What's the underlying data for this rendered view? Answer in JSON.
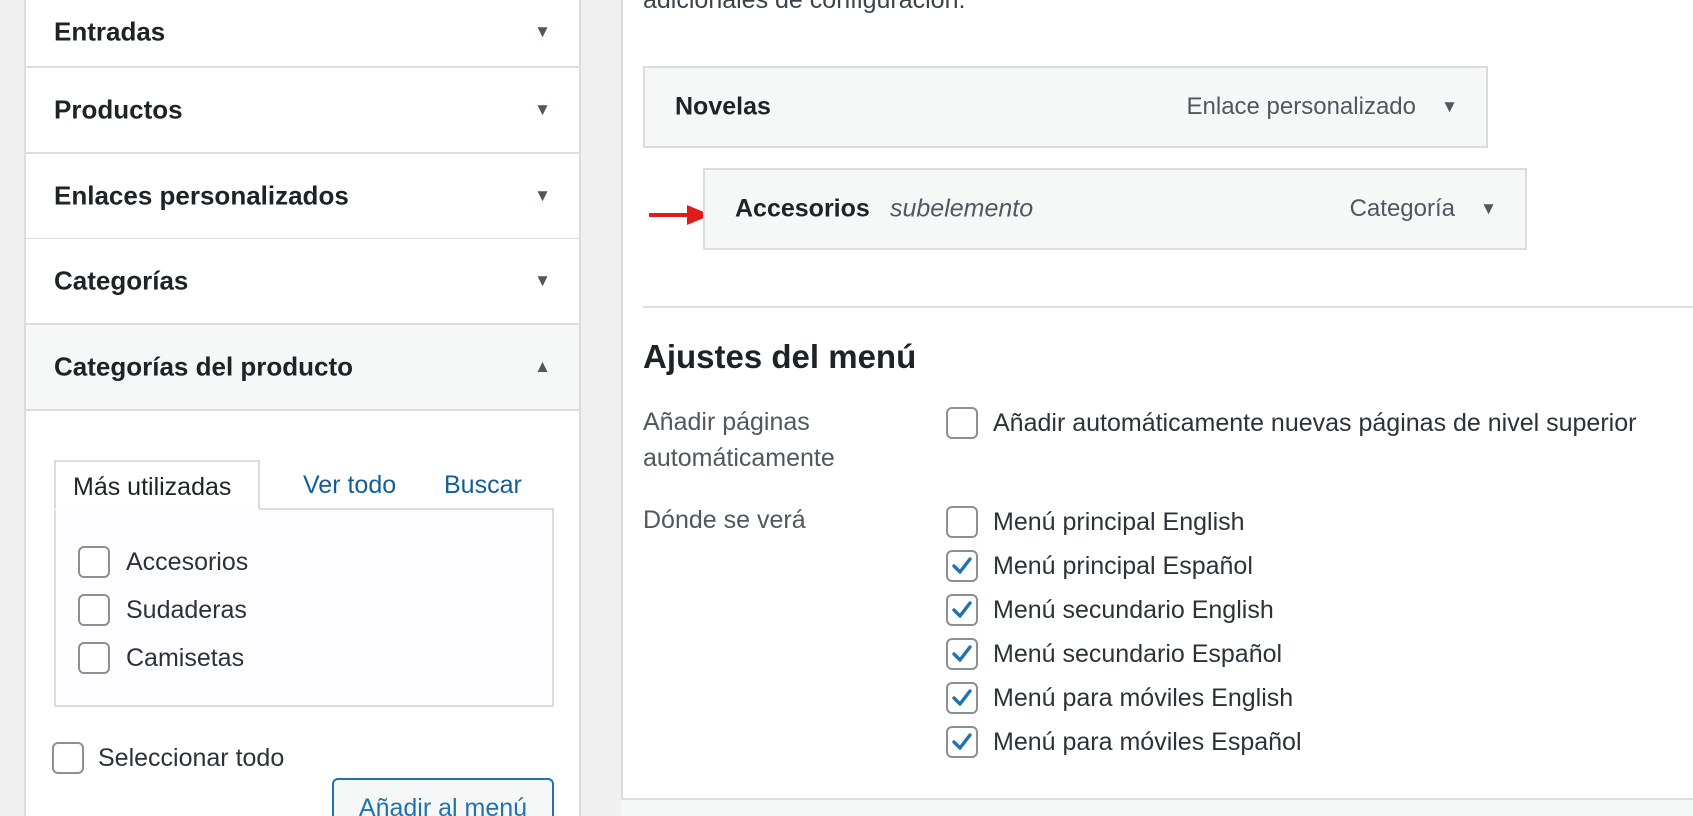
{
  "sidebar": {
    "sections": [
      {
        "label": "Entradas",
        "arrow": "▼"
      },
      {
        "label": "Productos",
        "arrow": "▼"
      },
      {
        "label": "Enlaces personalizados",
        "arrow": "▼"
      },
      {
        "label": "Categorías",
        "arrow": "▼"
      },
      {
        "label": "Categorías del producto",
        "arrow": "▲"
      }
    ],
    "tabs": {
      "most_used": "Más utilizadas",
      "view_all": "Ver todo",
      "search": "Buscar"
    },
    "items": [
      {
        "label": "Accesorios",
        "checked": false
      },
      {
        "label": "Sudaderas",
        "checked": false
      },
      {
        "label": "Camisetas",
        "checked": false
      }
    ],
    "select_all": "Seleccionar todo",
    "add_button": "Añadir al menú"
  },
  "main": {
    "intro_text": "adicionales de configuración.",
    "menu_items": [
      {
        "title": "Novelas",
        "subtitle": "",
        "type": "Enlace personalizado"
      },
      {
        "title": "Accesorios",
        "subtitle": "subelemento",
        "type": "Categoría"
      }
    ],
    "settings": {
      "title": "Ajustes del menú",
      "auto_add_label_line1": "Añadir páginas",
      "auto_add_label_line2": "automáticamente",
      "auto_add_option": "Añadir automáticamente nuevas páginas de nivel superior",
      "location_label": "Dónde se verá",
      "locations": [
        {
          "label": "Menú principal English",
          "checked": false
        },
        {
          "label": "Menú principal Español",
          "checked": true
        },
        {
          "label": "Menú secundario English",
          "checked": true
        },
        {
          "label": "Menú secundario Español",
          "checked": true
        },
        {
          "label": "Menú para móviles English",
          "checked": true
        },
        {
          "label": "Menú para móviles Español",
          "checked": true
        }
      ]
    }
  },
  "colors": {
    "accent": "#2271b1",
    "arrow": "#e01b1b",
    "link": "#135e96"
  }
}
